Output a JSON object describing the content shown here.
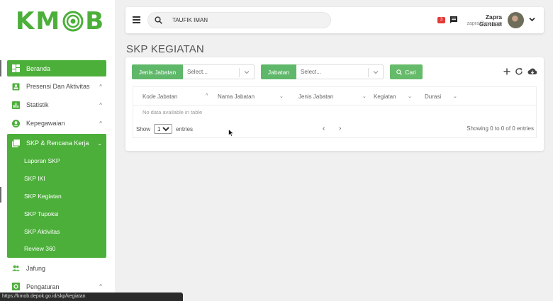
{
  "app": {
    "logo_text_left": "K",
    "logo_text_right": "B",
    "logo_letters_mid": "M",
    "brand_color": "#4caf3a"
  },
  "sidebar": {
    "items": [
      {
        "label": "Beranda",
        "icon": "dashboard-icon",
        "active": true
      },
      {
        "label": "Presensi Dan Aktivitas",
        "icon": "person-badge-icon",
        "chevron": "^"
      },
      {
        "label": "Statistik",
        "icon": "chart-icon",
        "chevron": "^"
      },
      {
        "label": "Kepegawaian",
        "icon": "account-circle-icon",
        "chevron": "^"
      },
      {
        "label": "SKP & Rencana Kerja",
        "icon": "library-icon",
        "chevron": "⌄",
        "expanded": true,
        "children": [
          "Laporan SKP",
          "SKP IKI",
          "SKP Kegiatan",
          "SKP Tupoksi",
          "SKP Aktivitas",
          "Review 360"
        ]
      },
      {
        "label": "Jafung",
        "icon": "people-icon"
      },
      {
        "label": "Pengaturan",
        "icon": "settings-icon",
        "chevron": "^"
      }
    ]
  },
  "header": {
    "search_value": "TAUFIK IMAN",
    "notification_count": "3",
    "user_name": "Zapra Gartiast",
    "user_email": "zapra@me.com"
  },
  "page": {
    "title": "SKP KEGIATAN",
    "filters": {
      "jenis_jabatan_label": "Jenis Jabatan",
      "jenis_jabatan_placeholder": "Select...",
      "jabatan_label": "Jabatan",
      "jabatan_placeholder": "Select...",
      "search_button": "Cari"
    },
    "table": {
      "columns": [
        "Kode Jabatan",
        "Nama Jabatan",
        "Jenis Jabatan",
        "Kegiatan",
        "Durasi"
      ],
      "empty_message": "No data available in table",
      "show_label": "Show",
      "entries_label": "entries",
      "page_size": "10",
      "prev": "‹",
      "next": "›",
      "info": "Showing 0 to 0 of 0 entries"
    }
  },
  "status_bar": {
    "url": "https://kmob.depok.go.id/skp/kegiatan"
  }
}
